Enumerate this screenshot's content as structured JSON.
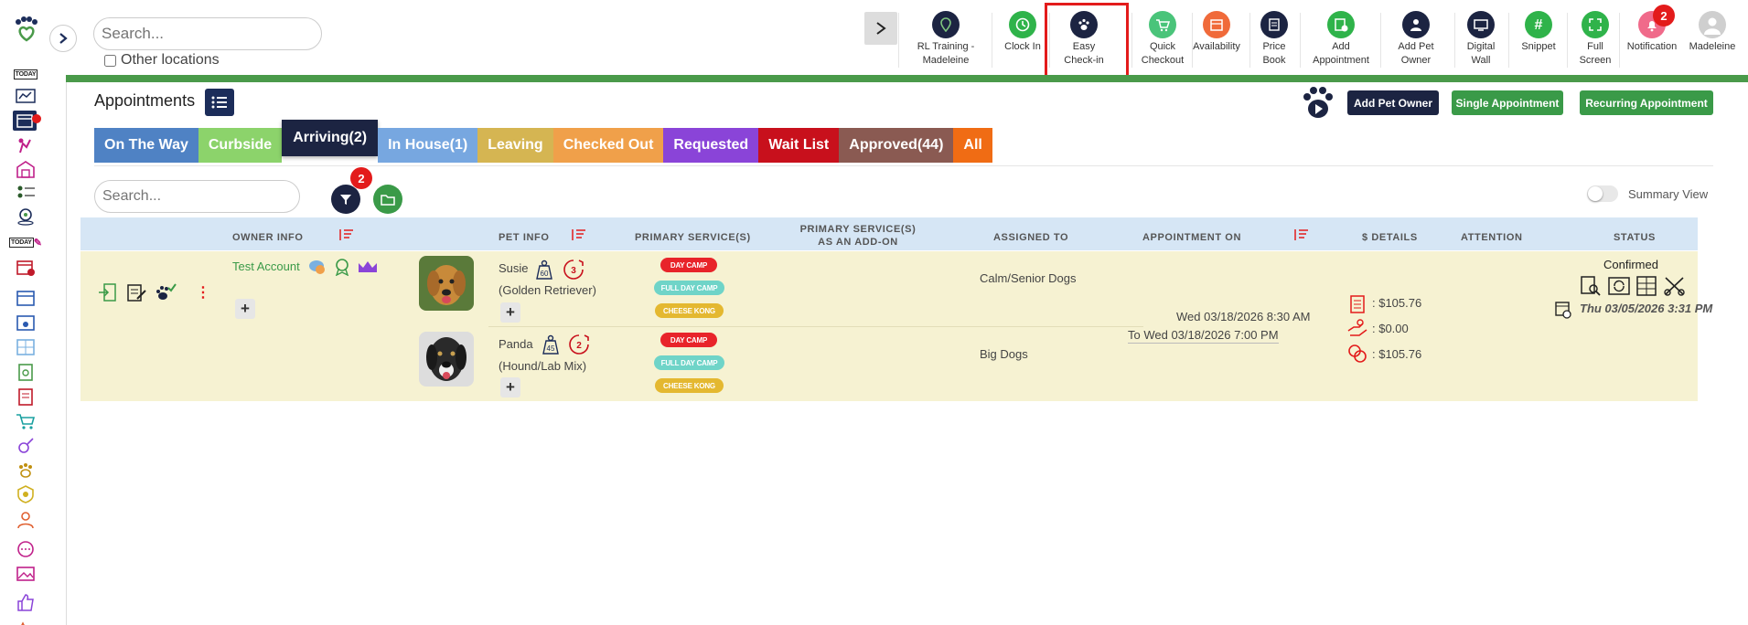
{
  "colors": {
    "brand_dark": "#1c2d5a",
    "green": "#4a9a4a",
    "highlight": "#e31b1b",
    "row_bg": "#f6f2d2",
    "header_bg": "#d6e6f5"
  },
  "top": {
    "search_placeholder": "Search...",
    "other_locations_label": "Other locations",
    "tools": [
      {
        "label": "RL Training - Madeleine",
        "icon": "location-pin-icon"
      },
      {
        "label": "Clock In",
        "icon": "clock-icon"
      },
      {
        "label": "Easy Check-in",
        "icon": "paw-icon"
      },
      {
        "label": "Quick Checkout",
        "icon": "cart-icon"
      },
      {
        "label": "Availability",
        "icon": "calendar-icon"
      },
      {
        "label": "Price Book",
        "icon": "document-icon"
      },
      {
        "label": "Add Appointment",
        "icon": "add-appointment-icon"
      },
      {
        "label": "Add Pet Owner",
        "icon": "add-user-icon"
      },
      {
        "label": "Digital Wall",
        "icon": "monitor-icon"
      },
      {
        "label": "Snippet",
        "icon": "hash-icon"
      },
      {
        "label": "Full Screen",
        "icon": "fullscreen-icon"
      },
      {
        "label": "Notification",
        "icon": "bell-icon",
        "badge": "2"
      },
      {
        "label": "Madeleine",
        "icon": "avatar-icon"
      }
    ]
  },
  "page": {
    "title": "Appointments",
    "add_pet_owner_label": "Add Pet Owner",
    "single_appointment_label": "Single Appointment",
    "recurring_appointment_label": "Recurring Appointment",
    "tabs": [
      {
        "label": "On The Way",
        "color": "#4f82c4"
      },
      {
        "label": "Curbside",
        "color": "#8cd36b"
      },
      {
        "label": "Arriving(2)",
        "color": "#1c2442",
        "active": true
      },
      {
        "label": "In House(1)",
        "color": "#77a7e0"
      },
      {
        "label": "Leaving",
        "color": "#d5b552"
      },
      {
        "label": "Checked Out",
        "color": "#f0a04a"
      },
      {
        "label": "Requested",
        "color": "#8a44d8"
      },
      {
        "label": "Wait List",
        "color": "#c8101c"
      },
      {
        "label": "Approved(44)",
        "color": "#8a5a52"
      },
      {
        "label": "All",
        "color": "#f06c14"
      }
    ],
    "list_search_placeholder": "Search...",
    "filter_badge": "2",
    "summary_view_label": "Summary View"
  },
  "table": {
    "headers": {
      "owner": "OWNER INFO",
      "pet": "PET INFO",
      "primary": "PRIMARY SERVICE(S)",
      "addon_1": "PRIMARY SERVICE(S)",
      "addon_2": "AS AN ADD-ON",
      "assigned": "ASSIGNED TO",
      "appt_on": "APPOINTMENT ON",
      "details": "$ DETAILS",
      "attention": "ATTENTION",
      "status": "STATUS"
    },
    "row": {
      "owner_name": "Test Account",
      "pets": [
        {
          "name": "Susie",
          "weight": "60",
          "count": "3",
          "breed": "(Golden Retriever)",
          "assigned": "Calm/Senior Dogs",
          "services": [
            "DAY CAMP",
            "FULL DAY CAMP",
            "CHEESE KONG"
          ]
        },
        {
          "name": "Panda",
          "weight": "45",
          "count": "2",
          "breed": "(Hound/Lab Mix)",
          "assigned": "Big Dogs",
          "services": [
            "DAY CAMP",
            "FULL DAY CAMP",
            "CHEESE KONG"
          ]
        }
      ],
      "appointment_from": "Wed 03/18/2026 8:30 AM",
      "appointment_to": "To Wed 03/18/2026 7:00 PM",
      "details": [
        ": $105.76",
        ": $0.00",
        ": $105.76"
      ],
      "status": "Confirmed",
      "status_date": "Thu 03/05/2026 3:31 PM"
    }
  }
}
